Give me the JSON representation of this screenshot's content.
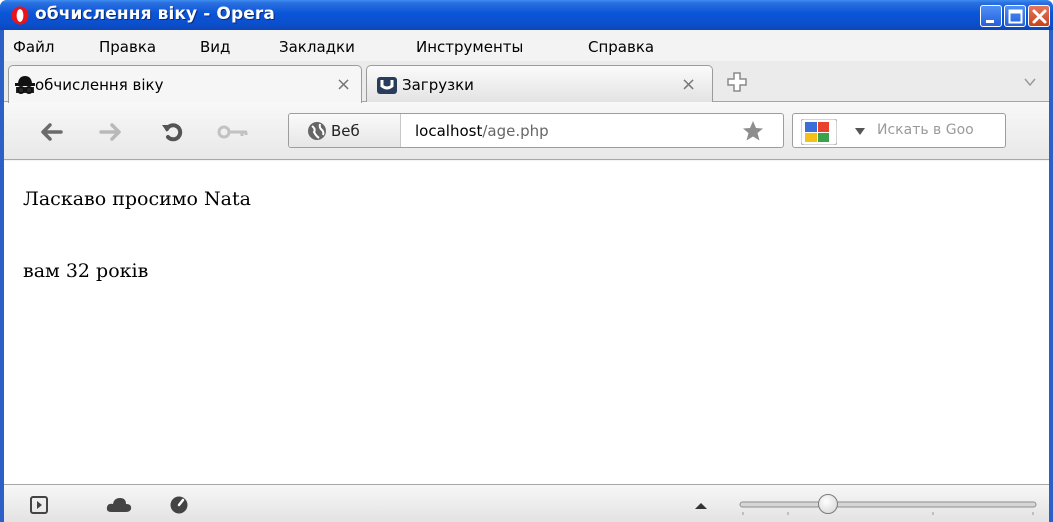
{
  "window": {
    "title": "обчислення віку - Opera"
  },
  "menu": [
    "Файл",
    "Правка",
    "Вид",
    "Закладки",
    "Инструменты",
    "Справка"
  ],
  "tabs": [
    {
      "label": "обчислення віку",
      "icon": "incognito-icon",
      "active": true,
      "close": "×"
    },
    {
      "label": "Загрузки",
      "icon": "downloads-icon",
      "active": false,
      "close": "×"
    }
  ],
  "address": {
    "badge": "Веб",
    "host": "localhost",
    "path": "/age.php"
  },
  "search": {
    "placeholder": "Искать в Goo"
  },
  "page": {
    "greeting": "Ласкаво просимо Nata",
    "age_text": "вам 32 років"
  },
  "statusbar": {
    "zoom_fraction": 0.3
  },
  "colors": {
    "titlebar": "#0a55d8",
    "close_button": "#c6421d",
    "frame": "#2d5fc9"
  }
}
